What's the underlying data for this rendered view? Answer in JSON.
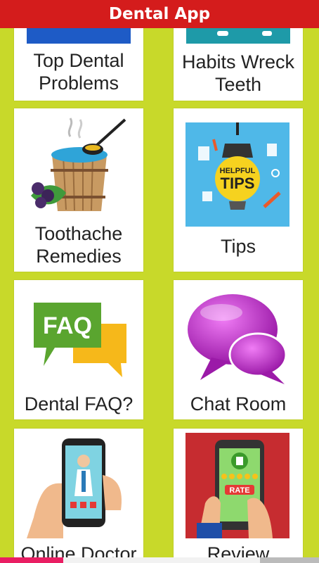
{
  "app": {
    "title": "Dental App"
  },
  "tiles": [
    {
      "label_line1": "Top Dental",
      "label_line2": "Problems"
    },
    {
      "label_line1": "Habits Wreck",
      "label_line2": "Teeth"
    },
    {
      "label_line1": "Toothache",
      "label_line2": "Remedies"
    },
    {
      "label": "Tips"
    },
    {
      "label": "Dental FAQ?"
    },
    {
      "label": "Chat Room"
    },
    {
      "label": "Online Doctor"
    },
    {
      "label": "Review"
    }
  ],
  "icons": {
    "tips_badge_line1": "HELPFUL",
    "tips_badge_line2": "TIPS",
    "faq_text": "FAQ",
    "review_badge": "RATE"
  },
  "colors": {
    "title_bar": "#d41c1c",
    "background": "#c8d92a",
    "card": "#ffffff"
  }
}
